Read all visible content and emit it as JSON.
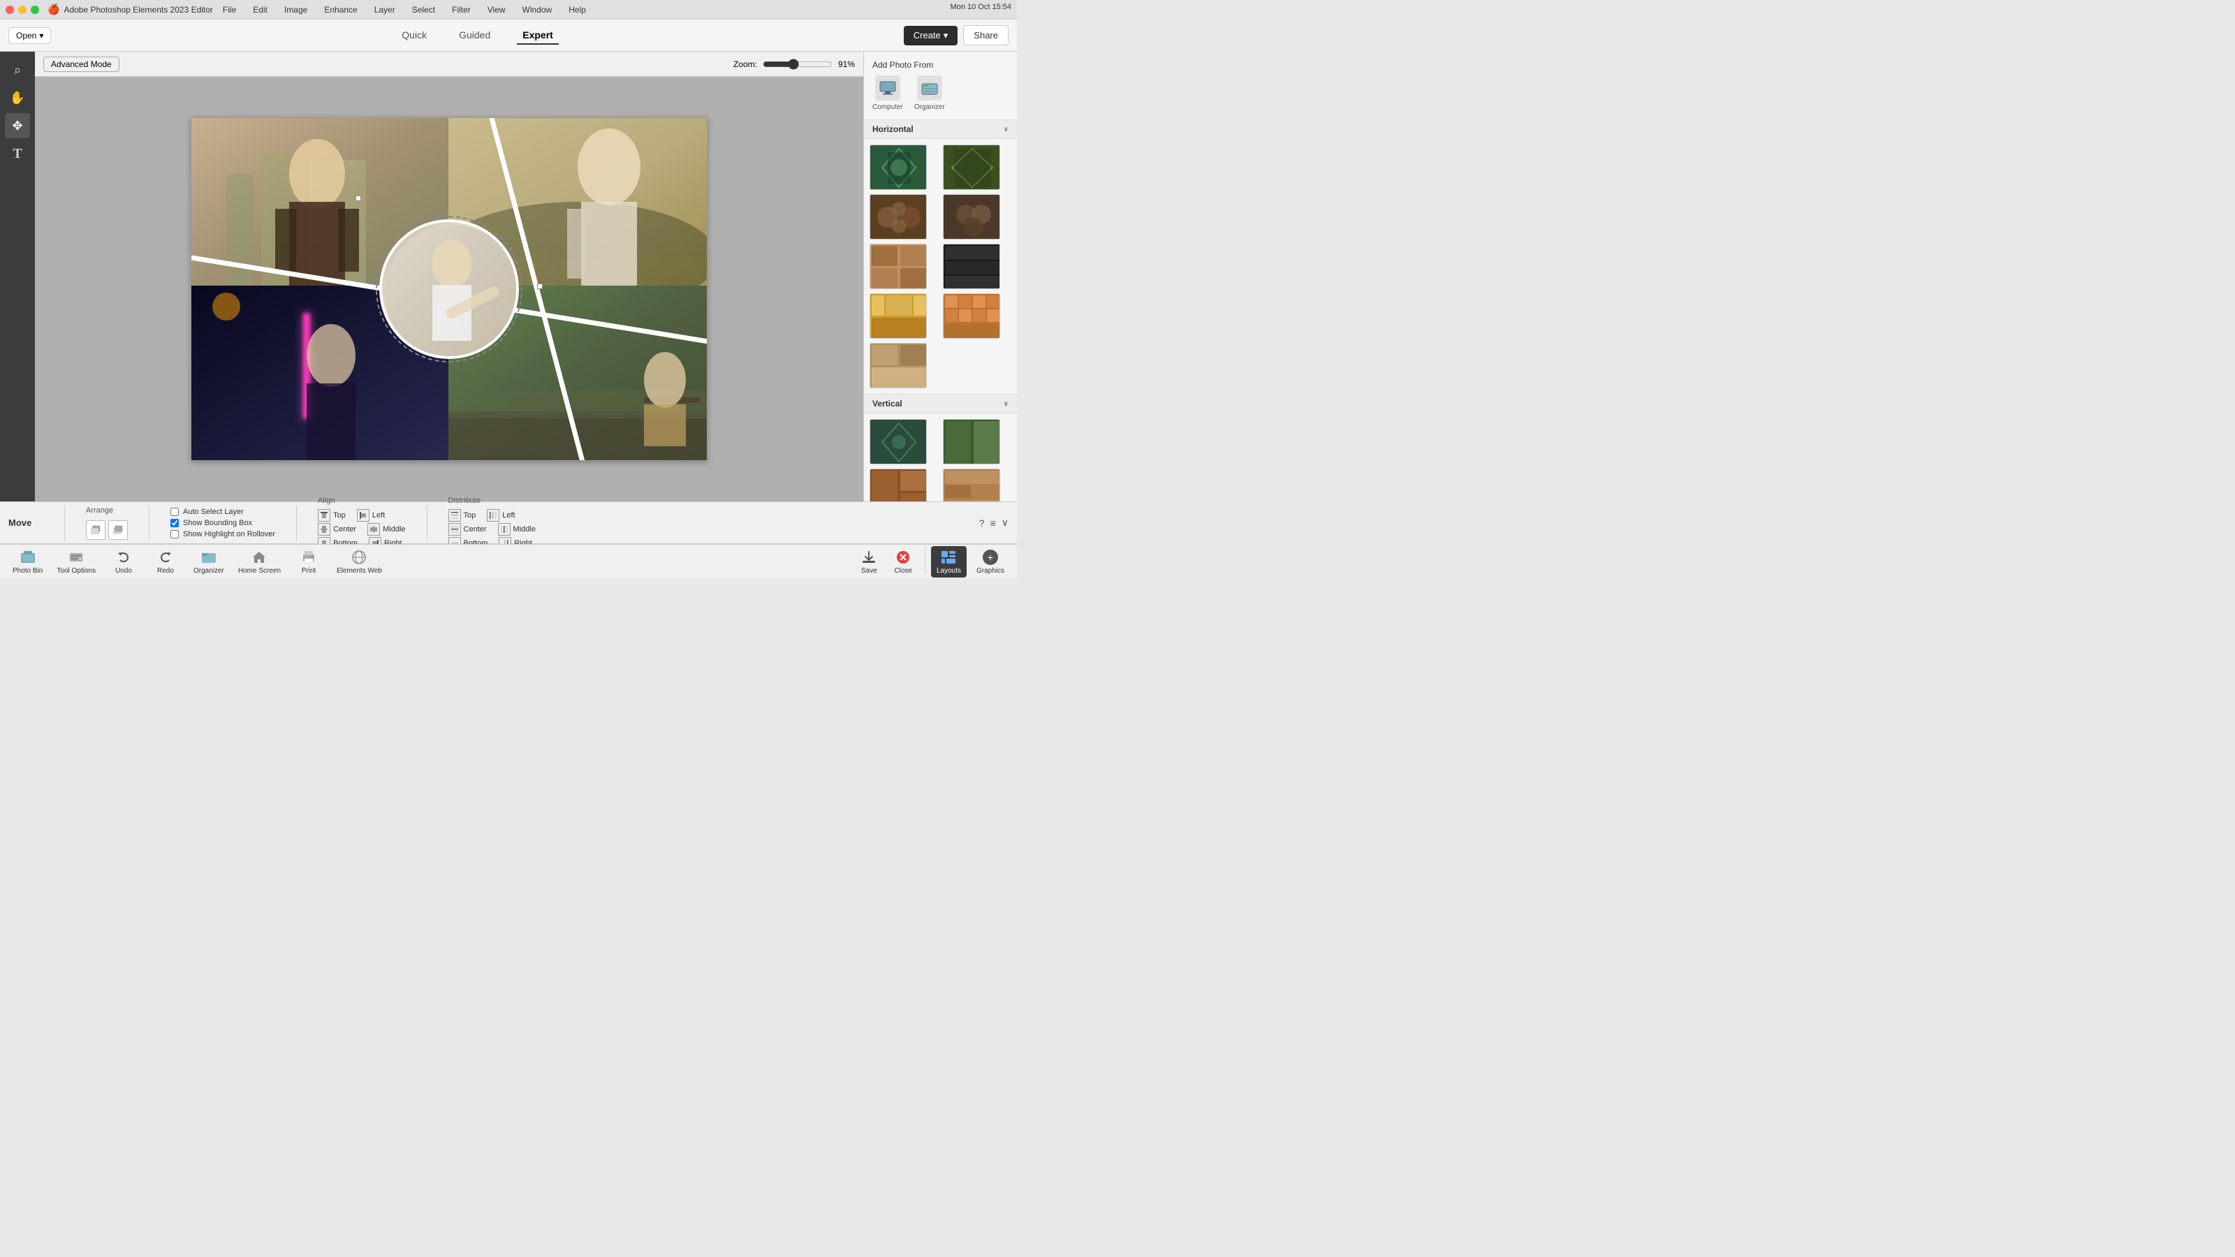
{
  "titleBar": {
    "appName": "Adobe Photoshop Elements 2023 Editor",
    "menus": [
      "File",
      "Edit",
      "Image",
      "Enhance",
      "Layer",
      "Select",
      "Filter",
      "View",
      "Window",
      "Help"
    ],
    "clock": "Mon 10 Oct  15:54"
  },
  "toolbar": {
    "openLabel": "Open",
    "modes": [
      "Quick",
      "Guided",
      "Expert"
    ],
    "activeMode": "Expert",
    "createLabel": "Create",
    "shareLabel": "Share",
    "zoomLabel": "Zoom:",
    "zoomValue": "91%"
  },
  "leftTools": [
    {
      "name": "zoom-tool",
      "icon": "⌕",
      "label": "Zoom"
    },
    {
      "name": "hand-tool",
      "icon": "✋",
      "label": "Hand"
    },
    {
      "name": "move-tool",
      "icon": "✥",
      "label": "Move"
    },
    {
      "name": "text-tool",
      "icon": "T",
      "label": "Text"
    }
  ],
  "canvasTopBar": {
    "advancedModeLabel": "Advanced Mode"
  },
  "rightPanel": {
    "addPhotoFrom": "Add Photo From",
    "sources": [
      {
        "label": "Computer",
        "icon": "🖥"
      },
      {
        "label": "Organizer",
        "icon": "📁"
      }
    ],
    "sections": [
      {
        "label": "Horizontal",
        "expanded": true,
        "layouts": [
          "green-diamond",
          "multicolor-diamond",
          "circle-collage-1",
          "circle-collage-2",
          "kids-photos",
          "autumn-strip",
          "bw-pattern",
          "yellow-grid",
          "mosaic-1",
          "single-center"
        ]
      },
      {
        "label": "Vertical",
        "expanded": true,
        "layouts": [
          "vert-green-heart",
          "vert-multicolor",
          "vert-food",
          "vert-kids-1",
          "vert-kids-2"
        ]
      }
    ]
  },
  "bottomBar": {
    "moveLabel": "Move",
    "arrangeLabel": "Arrange",
    "alignLabel": "Align",
    "distributeLabel": "Distribute",
    "checkboxes": [
      {
        "label": "Auto Select Layer",
        "checked": false
      },
      {
        "label": "Show Bounding Box",
        "checked": true
      },
      {
        "label": "Show Highlight on Rollover",
        "checked": false
      }
    ],
    "alignItems": {
      "top": "Top",
      "center": "Center",
      "bottom": "Bottom",
      "left": "Left",
      "middle": "Middle",
      "right": "Right"
    },
    "distributeItems": {
      "top": "Top",
      "center": "Center",
      "bottom": "Bottom",
      "left": "Left",
      "middle": "Middle",
      "right": "Right"
    },
    "bottomTools": [
      {
        "label": "Photo Bin",
        "active": false
      },
      {
        "label": "Tool Options",
        "active": false
      },
      {
        "label": "Undo",
        "active": false
      },
      {
        "label": "Redo",
        "active": false
      },
      {
        "label": "Organizer",
        "active": false
      },
      {
        "label": "Home Screen",
        "active": false
      },
      {
        "label": "Print",
        "active": false
      },
      {
        "label": "Elements Web",
        "active": false
      }
    ],
    "saveLabel": "Save",
    "closeLabel": "Close",
    "layoutsLabel": "Layouts",
    "graphicsLabel": "Graphics"
  }
}
